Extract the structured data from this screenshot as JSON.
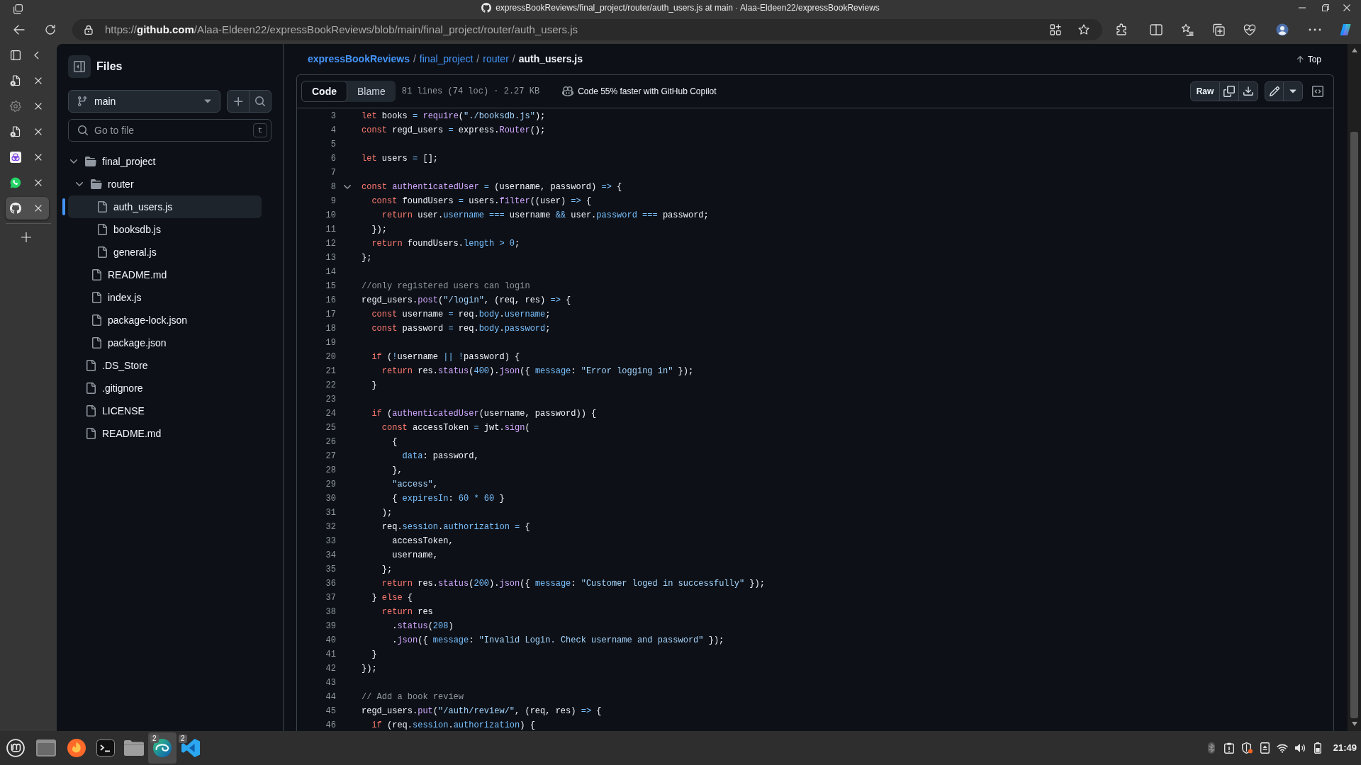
{
  "window": {
    "title": "expressBookReviews/final_project/router/auth_users.js at main · Alaa-Eldeen22/expressBookReviews"
  },
  "address_bar": {
    "scheme": "https://",
    "host": "github.com",
    "path": "/Alaa-Eldeen22/expressBookReviews/blob/main/final_project/router/auth_users.js"
  },
  "vertical_tabs": [
    {
      "kind": "document",
      "selected": false
    },
    {
      "kind": "gear",
      "selected": false
    },
    {
      "kind": "document",
      "selected": false
    },
    {
      "kind": "rings",
      "selected": false
    },
    {
      "kind": "chat",
      "selected": false
    },
    {
      "kind": "cat",
      "selected": true
    }
  ],
  "files_panel": {
    "title": "Files",
    "branch": "main",
    "search": {
      "placeholder": "Go to file",
      "shortcut": "t"
    },
    "tree": [
      {
        "kind": "folder",
        "name": "final_project",
        "expanded": true,
        "selected": false,
        "children": [
          {
            "kind": "folder",
            "name": "router",
            "expanded": true,
            "selected": false,
            "children": [
              {
                "kind": "file",
                "name": "auth_users.js",
                "selected": true
              },
              {
                "kind": "file",
                "name": "booksdb.js",
                "selected": false
              },
              {
                "kind": "file",
                "name": "general.js",
                "selected": false
              }
            ]
          },
          {
            "kind": "file",
            "name": "README.md",
            "selected": false
          },
          {
            "kind": "file",
            "name": "index.js",
            "selected": false
          },
          {
            "kind": "file",
            "name": "package-lock.json",
            "selected": false
          },
          {
            "kind": "file",
            "name": "package.json",
            "selected": false
          }
        ]
      },
      {
        "kind": "file",
        "name": ".DS_Store",
        "selected": false
      },
      {
        "kind": "file",
        "name": ".gitignore",
        "selected": false
      },
      {
        "kind": "file",
        "name": "LICENSE",
        "selected": false
      },
      {
        "kind": "file",
        "name": "README.md",
        "selected": false
      }
    ]
  },
  "breadcrumb": [
    {
      "kind": "repo",
      "text": "expressBookReviews"
    },
    {
      "kind": "separator",
      "text": "/"
    },
    {
      "kind": "link",
      "text": "final_project"
    },
    {
      "kind": "separator",
      "text": "/"
    },
    {
      "kind": "link",
      "text": "router"
    },
    {
      "kind": "separator",
      "text": "/"
    },
    {
      "kind": "current",
      "text": "auth_users.js"
    }
  ],
  "top_link": "Top",
  "file_header": {
    "tabs": [
      {
        "label": "Code",
        "selected": true
      },
      {
        "label": "Blame",
        "selected": false
      }
    ],
    "info": "81 lines (74 loc) · 2.27 KB",
    "promo": "Code 55% faster with GitHub Copilot",
    "raw": "Raw"
  },
  "code_lines": [
    {
      "number": "3",
      "tokens": [
        {
          "kind": "keyword",
          "text": "let"
        },
        {
          "kind": "plain",
          "text": " books "
        },
        {
          "kind": "constant",
          "text": "= "
        },
        {
          "kind": "function",
          "text": "require"
        },
        {
          "kind": "plain",
          "text": "("
        },
        {
          "kind": "string",
          "text": "\"./booksdb.js\""
        },
        {
          "kind": "plain",
          "text": ");"
        }
      ]
    },
    {
      "number": "4",
      "tokens": [
        {
          "kind": "keyword",
          "text": "const"
        },
        {
          "kind": "plain",
          "text": " regd_users "
        },
        {
          "kind": "constant",
          "text": "="
        },
        {
          "kind": "plain",
          "text": " express."
        },
        {
          "kind": "function",
          "text": "Router"
        },
        {
          "kind": "plain",
          "text": "();"
        }
      ]
    },
    {
      "number": "5"
    },
    {
      "number": "6",
      "tokens": [
        {
          "kind": "keyword",
          "text": "let"
        },
        {
          "kind": "plain",
          "text": " users "
        },
        {
          "kind": "constant",
          "text": "="
        },
        {
          "kind": "plain",
          "text": " [];"
        }
      ]
    },
    {
      "number": "7"
    },
    {
      "number": "8",
      "expanded": true,
      "tokens": [
        {
          "kind": "keyword",
          "text": "const "
        },
        {
          "kind": "function",
          "text": "authenticatedUser "
        },
        {
          "kind": "constant",
          "text": "="
        },
        {
          "kind": "plain",
          "text": " (username, password) "
        },
        {
          "kind": "constant",
          "text": "=>"
        },
        {
          "kind": "plain",
          "text": " {"
        }
      ]
    },
    {
      "number": "9",
      "tokens": [
        {
          "kind": "keyword",
          "text": "  const"
        },
        {
          "kind": "plain",
          "text": " foundUsers "
        },
        {
          "kind": "constant",
          "text": "="
        },
        {
          "kind": "plain",
          "text": " users."
        },
        {
          "kind": "function",
          "text": "filter"
        },
        {
          "kind": "plain",
          "text": "((user) "
        },
        {
          "kind": "constant",
          "text": "=>"
        },
        {
          "kind": "plain",
          "text": " {"
        }
      ]
    },
    {
      "number": "10",
      "tokens": [
        {
          "kind": "keyword",
          "text": "    return"
        },
        {
          "kind": "plain",
          "text": " user."
        },
        {
          "kind": "constant",
          "text": "username ==="
        },
        {
          "kind": "plain",
          "text": " username "
        },
        {
          "kind": "constant",
          "text": "&&"
        },
        {
          "kind": "plain",
          "text": " user."
        },
        {
          "kind": "constant",
          "text": "password ==="
        },
        {
          "kind": "plain",
          "text": " password;"
        }
      ]
    },
    {
      "number": "11",
      "tokens": [
        {
          "kind": "plain",
          "text": "  });"
        }
      ]
    },
    {
      "number": "12",
      "tokens": [
        {
          "kind": "keyword",
          "text": "  return"
        },
        {
          "kind": "plain",
          "text": " foundUsers."
        },
        {
          "kind": "constant",
          "text": "length > 0"
        },
        {
          "kind": "plain",
          "text": ";"
        }
      ]
    },
    {
      "number": "13",
      "tokens": [
        {
          "kind": "plain",
          "text": "};"
        }
      ]
    },
    {
      "number": "14"
    },
    {
      "number": "15",
      "tokens": [
        {
          "kind": "comment",
          "text": "//only registered users can login"
        }
      ]
    },
    {
      "number": "16",
      "tokens": [
        {
          "kind": "plain",
          "text": "regd_users."
        },
        {
          "kind": "function",
          "text": "post"
        },
        {
          "kind": "plain",
          "text": "("
        },
        {
          "kind": "string",
          "text": "\"/login\""
        },
        {
          "kind": "plain",
          "text": ", (req, res) "
        },
        {
          "kind": "constant",
          "text": "=>"
        },
        {
          "kind": "plain",
          "text": " {"
        }
      ]
    },
    {
      "number": "17",
      "tokens": [
        {
          "kind": "keyword",
          "text": "  const"
        },
        {
          "kind": "plain",
          "text": " username "
        },
        {
          "kind": "constant",
          "text": "="
        },
        {
          "kind": "plain",
          "text": " req."
        },
        {
          "kind": "constant",
          "text": "body"
        },
        {
          "kind": "plain",
          "text": "."
        },
        {
          "kind": "constant",
          "text": "username"
        },
        {
          "kind": "plain",
          "text": ";"
        }
      ]
    },
    {
      "number": "18",
      "tokens": [
        {
          "kind": "keyword",
          "text": "  const"
        },
        {
          "kind": "plain",
          "text": " password "
        },
        {
          "kind": "constant",
          "text": "="
        },
        {
          "kind": "plain",
          "text": " req."
        },
        {
          "kind": "constant",
          "text": "body"
        },
        {
          "kind": "plain",
          "text": "."
        },
        {
          "kind": "constant",
          "text": "password"
        },
        {
          "kind": "plain",
          "text": ";"
        }
      ]
    },
    {
      "number": "19"
    },
    {
      "number": "20",
      "tokens": [
        {
          "kind": "keyword",
          "text": "  if"
        },
        {
          "kind": "plain",
          "text": " ("
        },
        {
          "kind": "constant",
          "text": "!"
        },
        {
          "kind": "plain",
          "text": "username "
        },
        {
          "kind": "constant",
          "text": "|| !"
        },
        {
          "kind": "plain",
          "text": "password) {"
        }
      ]
    },
    {
      "number": "21",
      "tokens": [
        {
          "kind": "keyword",
          "text": "    return"
        },
        {
          "kind": "plain",
          "text": " res."
        },
        {
          "kind": "function",
          "text": "status"
        },
        {
          "kind": "plain",
          "text": "("
        },
        {
          "kind": "constant",
          "text": "400"
        },
        {
          "kind": "plain",
          "text": ")."
        },
        {
          "kind": "function",
          "text": "json"
        },
        {
          "kind": "plain",
          "text": "({ "
        },
        {
          "kind": "constant",
          "text": "message"
        },
        {
          "kind": "plain",
          "text": ": "
        },
        {
          "kind": "string",
          "text": "\"Error logging in\""
        },
        {
          "kind": "plain",
          "text": " });"
        }
      ]
    },
    {
      "number": "22",
      "tokens": [
        {
          "kind": "plain",
          "text": "  }"
        }
      ]
    },
    {
      "number": "23"
    },
    {
      "number": "24",
      "tokens": [
        {
          "kind": "keyword",
          "text": "  if"
        },
        {
          "kind": "plain",
          "text": " ("
        },
        {
          "kind": "function",
          "text": "authenticatedUser"
        },
        {
          "kind": "plain",
          "text": "(username, password)) {"
        }
      ]
    },
    {
      "number": "25",
      "tokens": [
        {
          "kind": "keyword",
          "text": "    const"
        },
        {
          "kind": "plain",
          "text": " accessToken "
        },
        {
          "kind": "constant",
          "text": "="
        },
        {
          "kind": "plain",
          "text": " jwt."
        },
        {
          "kind": "function",
          "text": "sign"
        },
        {
          "kind": "plain",
          "text": "("
        }
      ]
    },
    {
      "number": "26",
      "tokens": [
        {
          "kind": "plain",
          "text": "      {"
        }
      ]
    },
    {
      "number": "27",
      "tokens": [
        {
          "kind": "constant",
          "text": "        data"
        },
        {
          "kind": "plain",
          "text": ": password,"
        }
      ]
    },
    {
      "number": "28",
      "tokens": [
        {
          "kind": "plain",
          "text": "      },"
        }
      ]
    },
    {
      "number": "29",
      "tokens": [
        {
          "kind": "string",
          "text": "      \"access\""
        },
        {
          "kind": "plain",
          "text": ","
        }
      ]
    },
    {
      "number": "30",
      "tokens": [
        {
          "kind": "plain",
          "text": "      { "
        },
        {
          "kind": "constant",
          "text": "expiresIn"
        },
        {
          "kind": "plain",
          "text": ": "
        },
        {
          "kind": "constant",
          "text": "60 * 60"
        },
        {
          "kind": "plain",
          "text": " }"
        }
      ]
    },
    {
      "number": "31",
      "tokens": [
        {
          "kind": "plain",
          "text": "    );"
        }
      ]
    },
    {
      "number": "32",
      "tokens": [
        {
          "kind": "plain",
          "text": "    req."
        },
        {
          "kind": "constant",
          "text": "session"
        },
        {
          "kind": "plain",
          "text": "."
        },
        {
          "kind": "constant",
          "text": "authorization ="
        },
        {
          "kind": "plain",
          "text": " {"
        }
      ]
    },
    {
      "number": "33",
      "tokens": [
        {
          "kind": "plain",
          "text": "      accessToken,"
        }
      ]
    },
    {
      "number": "34",
      "tokens": [
        {
          "kind": "plain",
          "text": "      username,"
        }
      ]
    },
    {
      "number": "35",
      "tokens": [
        {
          "kind": "plain",
          "text": "    };"
        }
      ]
    },
    {
      "number": "36",
      "tokens": [
        {
          "kind": "keyword",
          "text": "    return"
        },
        {
          "kind": "plain",
          "text": " res."
        },
        {
          "kind": "function",
          "text": "status"
        },
        {
          "kind": "plain",
          "text": "("
        },
        {
          "kind": "constant",
          "text": "200"
        },
        {
          "kind": "plain",
          "text": ")."
        },
        {
          "kind": "function",
          "text": "json"
        },
        {
          "kind": "plain",
          "text": "({ "
        },
        {
          "kind": "constant",
          "text": "message"
        },
        {
          "kind": "plain",
          "text": ": "
        },
        {
          "kind": "string",
          "text": "\"Customer loged in successfully\""
        },
        {
          "kind": "plain",
          "text": " });"
        }
      ]
    },
    {
      "number": "37",
      "tokens": [
        {
          "kind": "plain",
          "text": "  } "
        },
        {
          "kind": "keyword",
          "text": "else"
        },
        {
          "kind": "plain",
          "text": " {"
        }
      ]
    },
    {
      "number": "38",
      "tokens": [
        {
          "kind": "keyword",
          "text": "    return"
        },
        {
          "kind": "plain",
          "text": " res"
        }
      ]
    },
    {
      "number": "39",
      "tokens": [
        {
          "kind": "plain",
          "text": "      ."
        },
        {
          "kind": "function",
          "text": "status"
        },
        {
          "kind": "plain",
          "text": "("
        },
        {
          "kind": "constant",
          "text": "208"
        },
        {
          "kind": "plain",
          "text": ")"
        }
      ]
    },
    {
      "number": "40",
      "tokens": [
        {
          "kind": "plain",
          "text": "      ."
        },
        {
          "kind": "function",
          "text": "json"
        },
        {
          "kind": "plain",
          "text": "({ "
        },
        {
          "kind": "constant",
          "text": "message"
        },
        {
          "kind": "plain",
          "text": ": "
        },
        {
          "kind": "string",
          "text": "\"Invalid Login. Check username and password\""
        },
        {
          "kind": "plain",
          "text": " });"
        }
      ]
    },
    {
      "number": "41",
      "tokens": [
        {
          "kind": "plain",
          "text": "  }"
        }
      ]
    },
    {
      "number": "42",
      "tokens": [
        {
          "kind": "plain",
          "text": "});"
        }
      ]
    },
    {
      "number": "43"
    },
    {
      "number": "44",
      "tokens": [
        {
          "kind": "comment",
          "text": "// Add a book review"
        }
      ]
    },
    {
      "number": "45",
      "tokens": [
        {
          "kind": "plain",
          "text": "regd_users."
        },
        {
          "kind": "function",
          "text": "put"
        },
        {
          "kind": "plain",
          "text": "("
        },
        {
          "kind": "string",
          "text": "\"/auth/review/\""
        },
        {
          "kind": "plain",
          "text": ", (req, res) "
        },
        {
          "kind": "constant",
          "text": "=>"
        },
        {
          "kind": "plain",
          "text": " {"
        }
      ]
    },
    {
      "number": "46",
      "tokens": [
        {
          "kind": "keyword",
          "text": "  if"
        },
        {
          "kind": "plain",
          "text": " (req."
        },
        {
          "kind": "constant",
          "text": "session"
        },
        {
          "kind": "plain",
          "text": "."
        },
        {
          "kind": "constant",
          "text": "authorization"
        },
        {
          "kind": "plain",
          "text": ") {"
        }
      ]
    }
  ],
  "taskbar": {
    "apps": [
      {
        "kind": "menu",
        "selected": false
      },
      {
        "kind": "window",
        "selected": false
      },
      {
        "kind": "flame",
        "selected": false
      },
      {
        "kind": "terminal",
        "selected": false
      },
      {
        "kind": "folder",
        "selected": false
      },
      {
        "kind": "swirl",
        "selected": true,
        "count": "2"
      },
      {
        "kind": "ribbon",
        "selected": false,
        "count": "2"
      }
    ],
    "clock": "21:49"
  }
}
